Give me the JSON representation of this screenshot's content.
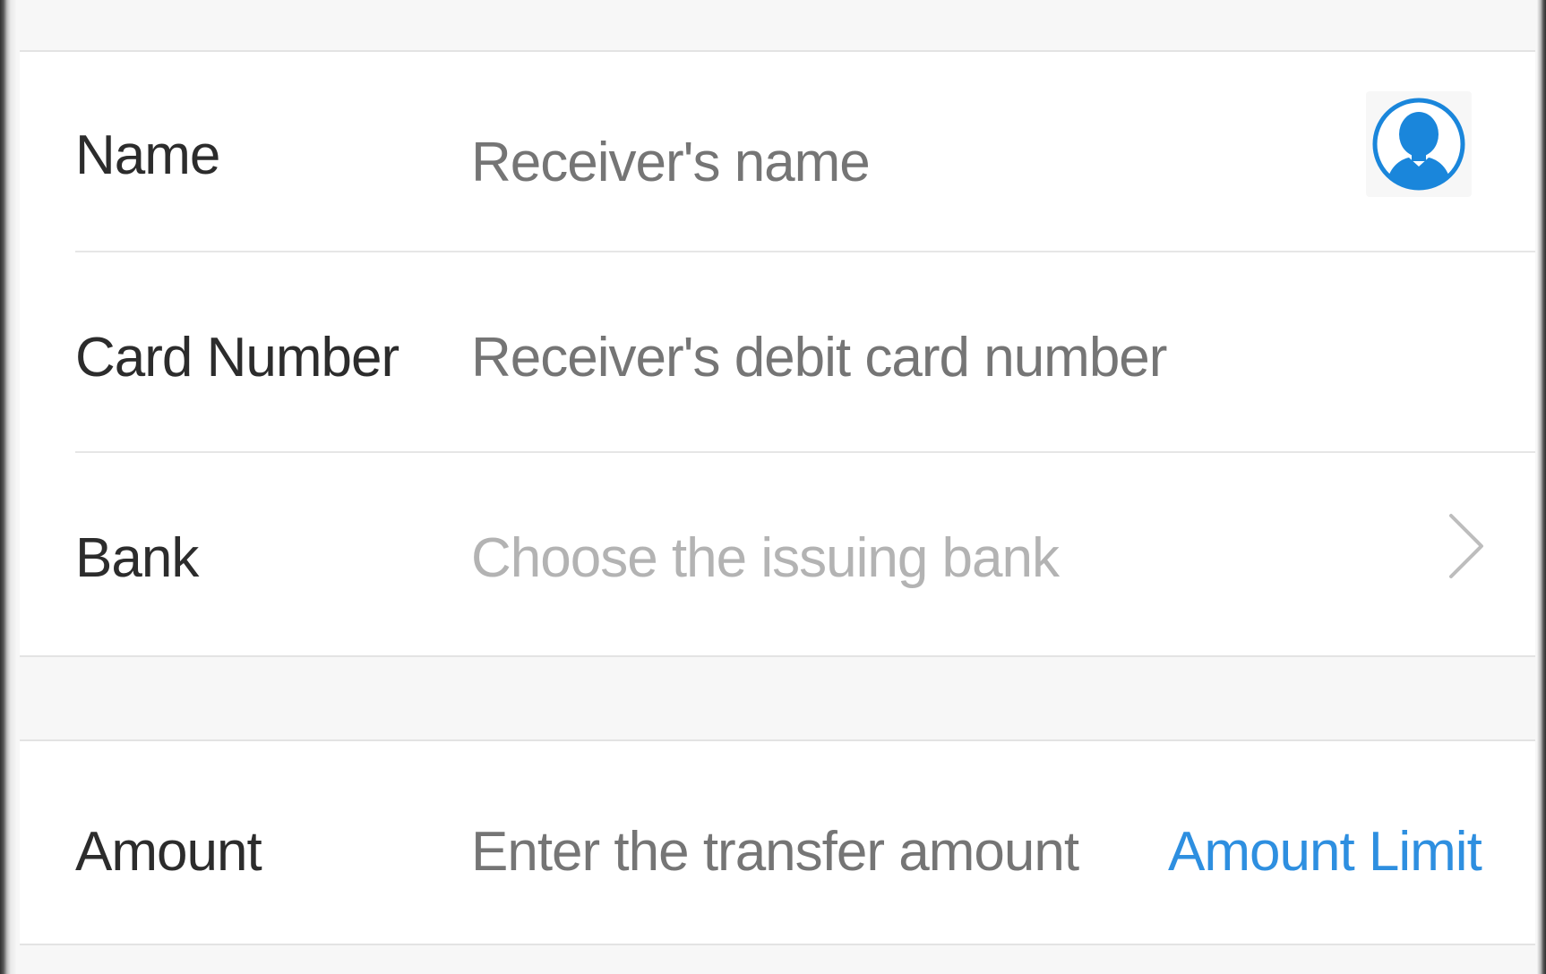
{
  "form": {
    "name": {
      "label": "Name",
      "placeholder": "Receiver's name",
      "icon": "contact-person-icon"
    },
    "card_number": {
      "label": "Card Number",
      "placeholder": "Receiver's debit card number"
    },
    "bank": {
      "label": "Bank",
      "placeholder": "Choose the issuing bank",
      "icon": "chevron-right-icon"
    },
    "amount": {
      "label": "Amount",
      "placeholder": "Enter the transfer amount",
      "limit_link": "Amount Limit"
    }
  },
  "colors": {
    "accent": "#2e8fe0",
    "label": "#2c2c2c",
    "placeholder": "#b3b3b3",
    "background": "#f7f7f7",
    "divider": "#e6e6e6"
  }
}
